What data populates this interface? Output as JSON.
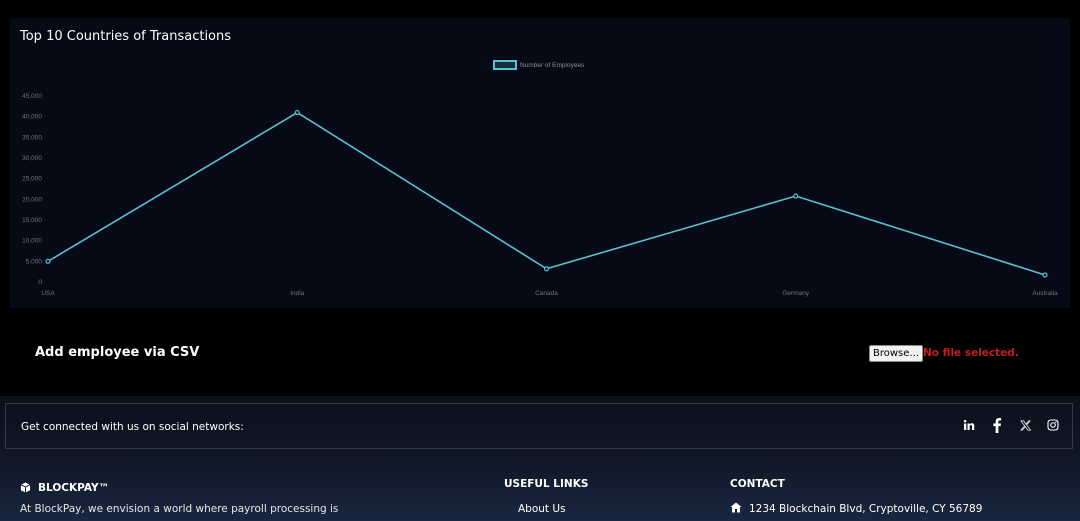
{
  "chart_data": {
    "type": "line",
    "title": "Top 10 Countries of Transactions",
    "categories": [
      "USA",
      "India",
      "Canada",
      "Germany",
      "Australia"
    ],
    "series": [
      {
        "name": "Number of Employees",
        "values": [
          5000,
          41000,
          3200,
          20800,
          1700
        ]
      }
    ],
    "ylim": [
      0,
      45000
    ],
    "yticks": [
      "0",
      "5,000",
      "10,000",
      "15,000",
      "20,000",
      "25,000",
      "30,000",
      "35,000",
      "40,000",
      "45,000"
    ],
    "legend": "top-center",
    "grid": false,
    "line_color": "#5bc0d0"
  },
  "csv": {
    "title": "Add employee via CSV",
    "browse_label": "Browse...",
    "file_status": "No file selected."
  },
  "footer": {
    "social_text": "Get connected with us on social networks:",
    "social_icons": [
      "linkedin-icon",
      "facebook-icon",
      "x-icon",
      "instagram-icon"
    ],
    "brand_name": "BLOCKPAY™",
    "about_text": "At BlockPay, we envision a world where payroll processing is",
    "useful_links_title": "USEFUL LINKS",
    "useful_links": [
      "About Us"
    ],
    "contact_title": "CONTACT",
    "contact_address": "1234 Blockchain Blvd, Cryptoville, CY 56789"
  }
}
